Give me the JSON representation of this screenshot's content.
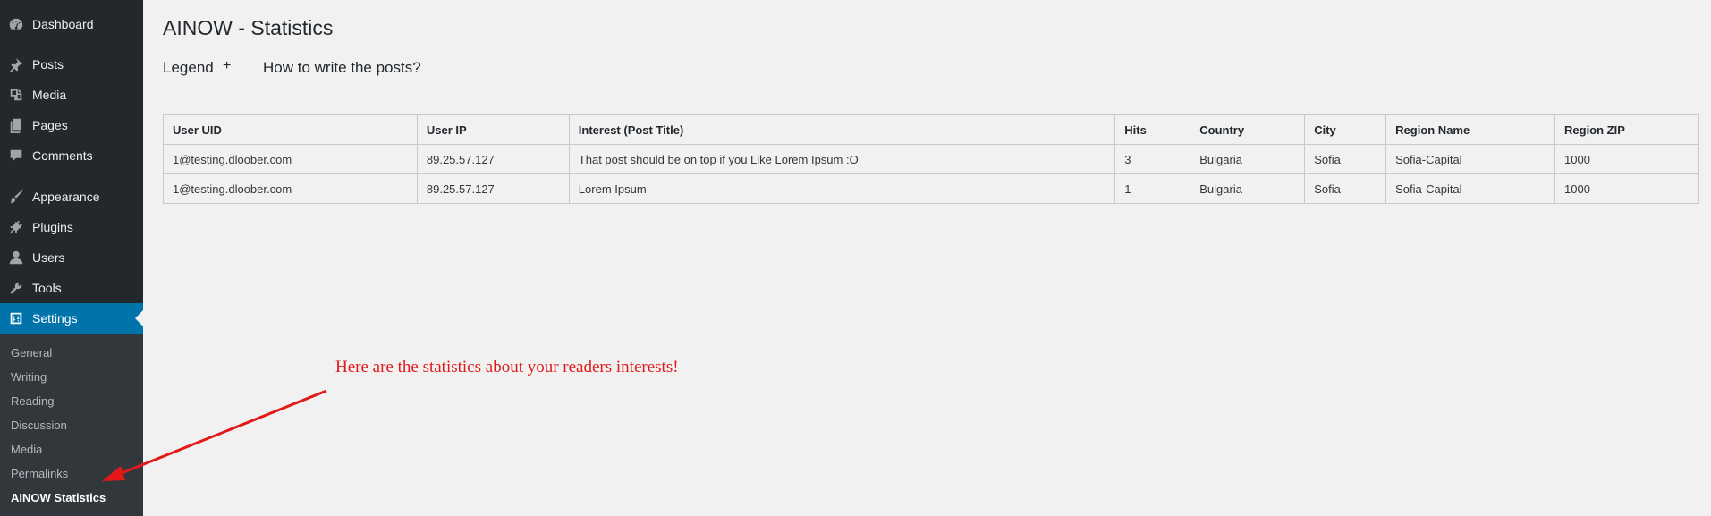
{
  "sidebar": {
    "items": [
      {
        "label": "Dashboard",
        "icon": "dashboard-icon"
      },
      {
        "label": "Posts",
        "icon": "pin-icon"
      },
      {
        "label": "Media",
        "icon": "media-icon"
      },
      {
        "label": "Pages",
        "icon": "pages-icon"
      },
      {
        "label": "Comments",
        "icon": "comment-icon"
      },
      {
        "label": "Appearance",
        "icon": "brush-icon"
      },
      {
        "label": "Plugins",
        "icon": "plugin-icon"
      },
      {
        "label": "Users",
        "icon": "user-icon"
      },
      {
        "label": "Tools",
        "icon": "wrench-icon"
      },
      {
        "label": "Settings",
        "icon": "settings-icon"
      }
    ],
    "submenu": [
      "General",
      "Writing",
      "Reading",
      "Discussion",
      "Media",
      "Permalinks",
      "AINOW Statistics"
    ],
    "active_color": "#0073aa",
    "bg_color": "#23282d"
  },
  "main": {
    "title": "AINOW - Statistics",
    "tabs": {
      "legend": "Legend",
      "plus": "+",
      "howto": "How to write the posts?"
    },
    "table": {
      "headers": [
        "User UID",
        "User IP",
        "Interest (Post Title)",
        "Hits",
        "Country",
        "City",
        "Region Name",
        "Region ZIP"
      ],
      "rows": [
        [
          "1@testing.dloober.com",
          "89.25.57.127",
          "That post should be on top if you Like Lorem Ipsum :O",
          "3",
          "Bulgaria",
          "Sofia",
          "Sofia-Capital",
          "1000"
        ],
        [
          "1@testing.dloober.com",
          "89.25.57.127",
          "Lorem Ipsum",
          "1",
          "Bulgaria",
          "Sofia",
          "Sofia-Capital",
          "1000"
        ]
      ]
    }
  },
  "annotation": {
    "text": "Here are the statistics about your readers interests!",
    "color": "#e31919"
  }
}
